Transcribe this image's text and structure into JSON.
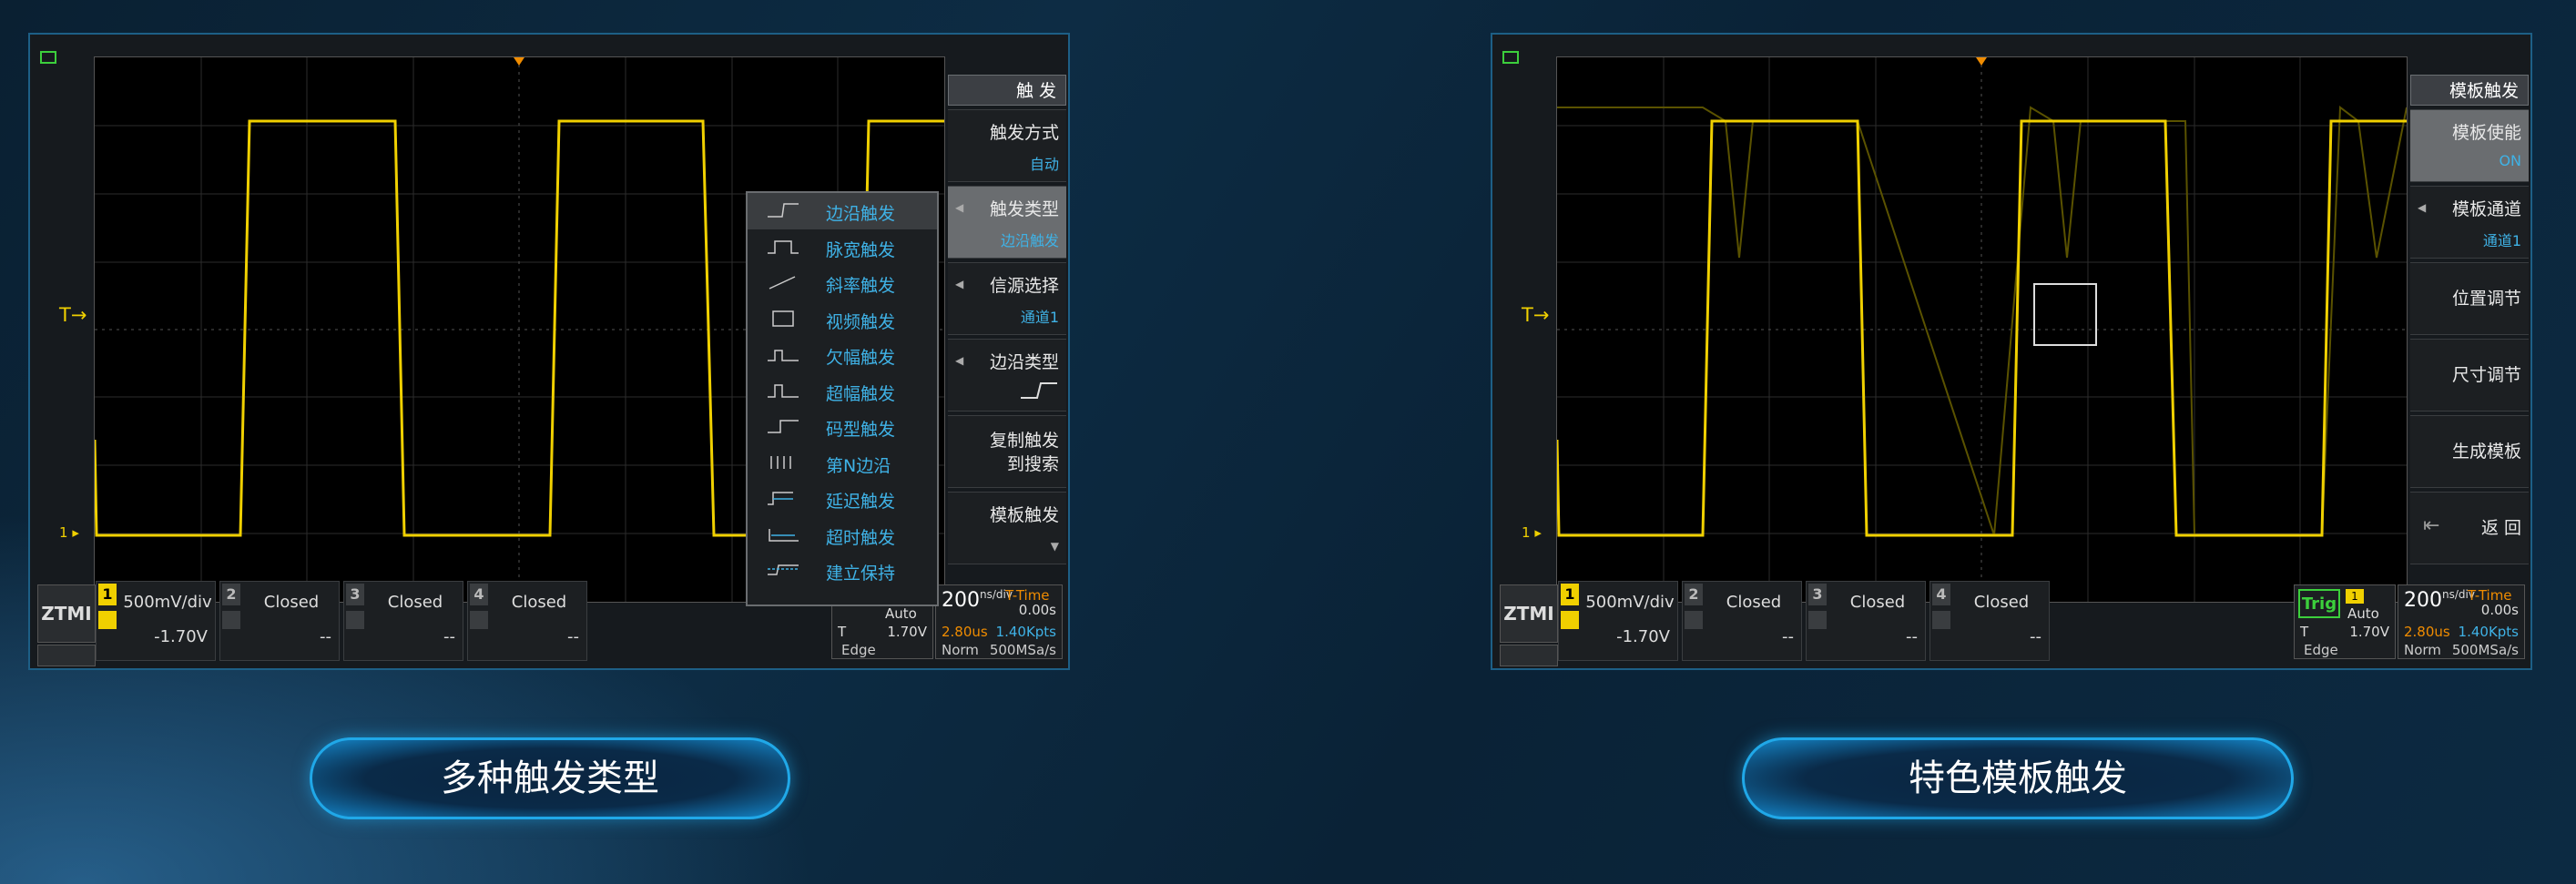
{
  "colors": {
    "trace": "#f0d000",
    "accent": "#3fb2e6",
    "border": "#20a8e8"
  },
  "left": {
    "menu_title": "触 发",
    "menu": [
      {
        "label": "触发方式",
        "value": "自动",
        "selected": false
      },
      {
        "label": "触发类型",
        "value": "边沿触发",
        "selected": true
      },
      {
        "label": "信源选择",
        "value": "通道1",
        "selected": false
      },
      {
        "label": "边沿类型",
        "value": "",
        "selected": false
      },
      {
        "label": "复制触发\n到搜索",
        "value": "",
        "selected": false
      },
      {
        "label": "模板触发",
        "value": "",
        "selected": false
      }
    ],
    "popup": [
      "边沿触发",
      "脉宽触发",
      "斜率触发",
      "视频触发",
      "欠幅触发",
      "超幅触发",
      "码型触发",
      "第N边沿",
      "延迟触发",
      "超时触发",
      "建立保持"
    ],
    "caption": "多种触发类型"
  },
  "right": {
    "menu_title": "模板触发",
    "menu": [
      {
        "label": "模板使能",
        "value": "ON",
        "selected": true
      },
      {
        "label": "模板通道",
        "value": "通道1",
        "selected": false
      },
      {
        "label": "位置调节",
        "value": "",
        "selected": false
      },
      {
        "label": "尺寸调节",
        "value": "",
        "selected": false
      },
      {
        "label": "生成模板",
        "value": "",
        "selected": false
      },
      {
        "label": "返 回",
        "value": "",
        "selected": false
      }
    ],
    "caption": "特色模板触发"
  },
  "common": {
    "trigger_marker": "T",
    "ch1_marker": "1",
    "logo": "ZTMI",
    "channels": [
      {
        "num": "1",
        "value": "500mV/div",
        "offset": "-1.70V",
        "on": true
      },
      {
        "num": "2",
        "value": "Closed",
        "offset": "--",
        "on": false
      },
      {
        "num": "3",
        "value": "Closed",
        "offset": "--",
        "on": false
      },
      {
        "num": "4",
        "value": "Closed",
        "offset": "--",
        "on": false
      }
    ],
    "timebase": {
      "value": "200",
      "unit": "ns/div",
      "mode": "T-Time",
      "offset": "0.00s",
      "time": "2.80us",
      "points": "1.40Kpts",
      "acq": "Norm",
      "rate": "500MSa/s"
    },
    "trigger": {
      "badge": "Trig",
      "src": "1",
      "mode": "Auto",
      "t": "T",
      "level": "1.70V",
      "type": "Edge"
    }
  }
}
